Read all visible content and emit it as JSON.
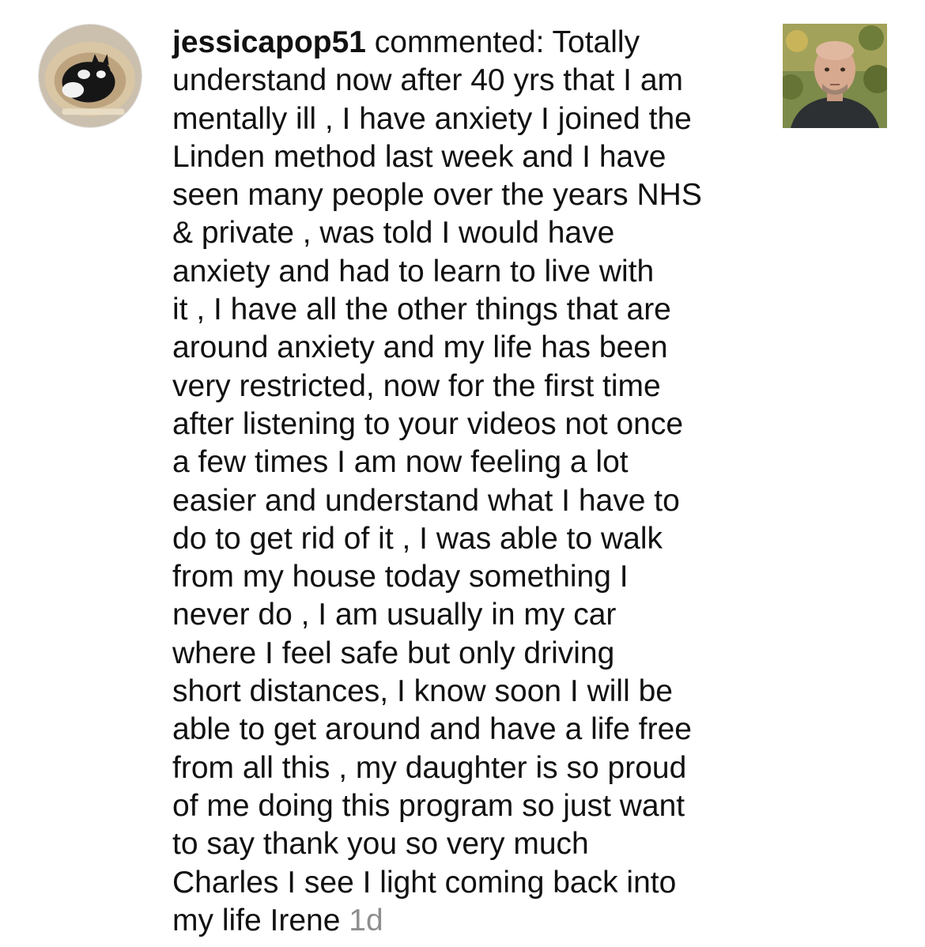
{
  "notification": {
    "username": "jessicapop51",
    "action_text": " commented: Totally",
    "comment_lines": [
      "understand now after 40 yrs that I am",
      "mentally ill , I have anxiety I joined the",
      "Linden method last week and I have",
      "seen many people over the years NHS",
      "& private , was told I would have",
      "anxiety and had to learn to live with",
      "it , I have all the other things that are",
      "around anxiety and my life has been",
      "very restricted, now for the first time",
      "after listening to your videos not once",
      "a few times I am now feeling a lot",
      "easier and understand what I have to",
      "do to get rid of it , I was able to walk",
      "from my house today something I",
      "never do , I am usually in my car",
      "where I feel safe but only driving",
      "short distances, I know soon I will be",
      "able to get around and have a life free",
      "from all this , my daughter is so proud",
      "of me doing this program so just want",
      "to say thank you so very much",
      "Charles I see I light coming back into"
    ],
    "last_line_text": "my life Irene ",
    "timestamp": "1d",
    "avatar_icon": "profile-photo-cat",
    "thumbnail_icon": "post-thumbnail-man-portrait"
  },
  "colors": {
    "text": "#111111",
    "timestamp": "#8e8e8e",
    "background": "#ffffff"
  }
}
